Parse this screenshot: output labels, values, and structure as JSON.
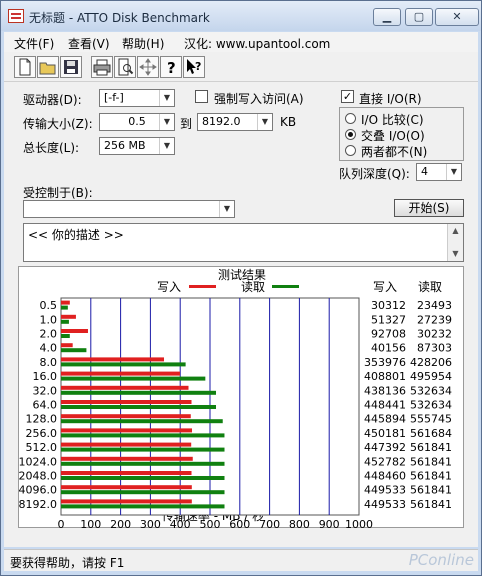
{
  "window": {
    "title": "无标题 - ATTO Disk Benchmark"
  },
  "menu": {
    "items": [
      "文件(F)",
      "查看(V)",
      "帮助(H)",
      "汉化: www.upantool.com"
    ]
  },
  "toolbar": {
    "icons": [
      "new-file-icon",
      "open-folder-icon",
      "save-disk-icon",
      "print-icon",
      "print-preview-icon",
      "move-cross-icon",
      "help-question-icon",
      "context-help-icon"
    ]
  },
  "settings": {
    "drive_label": "驱动器(D):",
    "drive_value": "[-f-]",
    "force_write_label": "强制写入访问(A)",
    "transfer_label": "传输大小(Z):",
    "transfer_from": "0.5",
    "to_label": "到",
    "transfer_to": "8192.0",
    "kb_label": "KB",
    "total_label": "总长度(L):",
    "total_value": "256 MB",
    "controlled_label": "受控制于(B):",
    "controlled_value": "",
    "direct_io_label": "直接 I/O(R)",
    "io_compare_label": "I/O 比较(C)",
    "overlapped_io_label": "交叠 I/O(O)",
    "neither_label": "两者都不(N)",
    "queue_label": "队列深度(Q):",
    "queue_value": "4",
    "start_label": "开始(S)",
    "description": "<<  你的描述  >>"
  },
  "results": {
    "title": "测试结果",
    "write_legend": "写入",
    "read_legend": "读取",
    "col_write": "写入",
    "col_read": "读取",
    "xlabel": "传输速率 - MB / 秒"
  },
  "status": {
    "text": "要获得帮助，请按 F1"
  },
  "watermark": "PConline",
  "chart_data": {
    "type": "bar",
    "title": "测试结果",
    "xlabel": "传输速率 - MB / 秒",
    "xlim": [
      0,
      1000
    ],
    "xticks": [
      0,
      100,
      200,
      300,
      400,
      500,
      600,
      700,
      800,
      900,
      1000
    ],
    "categories": [
      "0.5",
      "1.0",
      "2.0",
      "4.0",
      "8.0",
      "16.0",
      "32.0",
      "64.0",
      "128.0",
      "256.0",
      "512.0",
      "1024.0",
      "2048.0",
      "4096.0",
      "8192.0"
    ],
    "series": [
      {
        "name": "写入",
        "color": "#e02020",
        "values": [
          30312,
          51327,
          92708,
          40156,
          353976,
          408801,
          438136,
          448441,
          445894,
          450181,
          447392,
          452782,
          448460,
          449533,
          449533
        ]
      },
      {
        "name": "读取",
        "color": "#108010",
        "values": [
          23493,
          27239,
          30232,
          87303,
          428206,
          495954,
          532634,
          532634,
          555745,
          561684,
          561841,
          561841,
          561841,
          561841,
          561841
        ]
      }
    ]
  }
}
